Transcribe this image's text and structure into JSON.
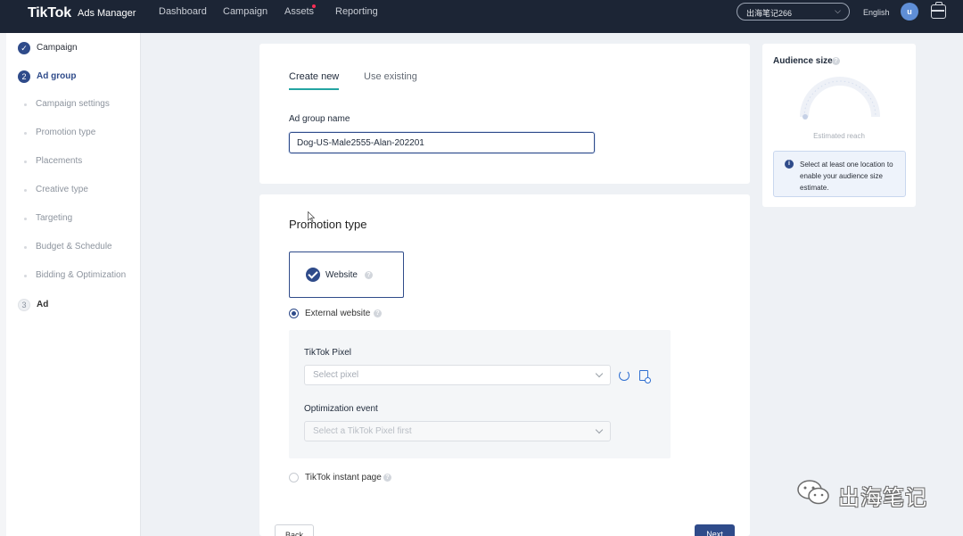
{
  "header": {
    "logo": "TikTok",
    "logo_sub": "Ads Manager",
    "nav": [
      "Dashboard",
      "Campaign",
      "Assets",
      "Reporting"
    ],
    "account": "出海笔记266",
    "language": "English",
    "avatar_initial": "u"
  },
  "sidebar": {
    "campaign": "Campaign",
    "ad_group_number": "2",
    "ad_group": "Ad group",
    "substeps": [
      "Campaign settings",
      "Promotion type",
      "Placements",
      "Creative type",
      "Targeting",
      "Budget & Schedule",
      "Bidding & Optimization"
    ],
    "ad_number": "3",
    "ad": "Ad"
  },
  "ad_group_card": {
    "tab_create": "Create new",
    "tab_existing": "Use existing",
    "name_label": "Ad group name",
    "name_value": "Dog-US-Male2555-Alan-202201"
  },
  "promotion": {
    "title": "Promotion type",
    "option_website": "Website",
    "external_website": "External website",
    "pixel_label": "TikTok Pixel",
    "pixel_placeholder": "Select pixel",
    "optimization_label": "Optimization event",
    "optimization_placeholder": "Select a TikTok Pixel first",
    "instant_page": "TikTok instant page"
  },
  "footer": {
    "back": "Back",
    "next": "Next"
  },
  "audience": {
    "title": "Audience size",
    "estimated_reach": "Estimated reach",
    "info": "Select at least one location to enable your audience size estimate."
  },
  "watermark": {
    "text": "出海笔记"
  },
  "colors": {
    "primary": "#2f4b8a",
    "tab_underline": "#23a4a2",
    "topbar": "#1c2535"
  }
}
